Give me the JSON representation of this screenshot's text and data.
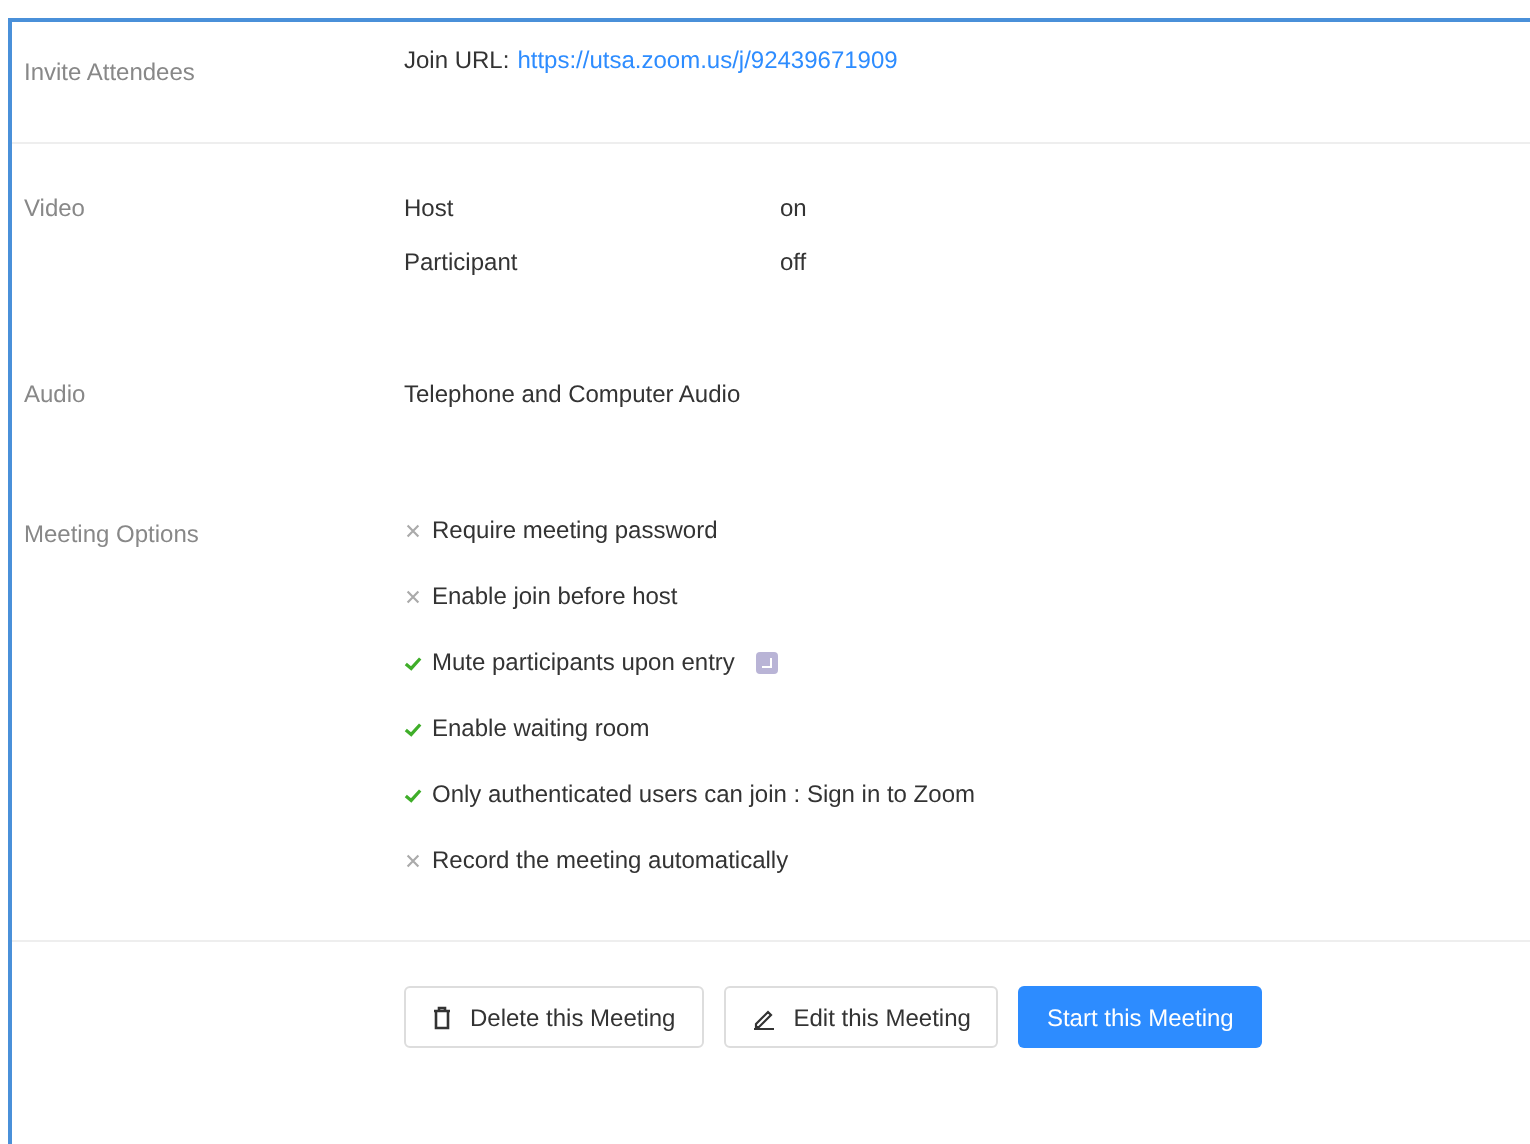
{
  "invite": {
    "label": "Invite Attendees",
    "url_label": "Join URL:",
    "url": "https://utsa.zoom.us/j/92439671909"
  },
  "video": {
    "label": "Video",
    "settings": [
      {
        "name": "Host",
        "value": "on"
      },
      {
        "name": "Participant",
        "value": "off"
      }
    ]
  },
  "audio": {
    "label": "Audio",
    "value": "Telephone and Computer Audio"
  },
  "meeting_options": {
    "label": "Meeting Options",
    "options": [
      {
        "text": "Require meeting password",
        "enabled": false,
        "badge": false
      },
      {
        "text": "Enable join before host",
        "enabled": false,
        "badge": false
      },
      {
        "text": "Mute participants upon entry",
        "enabled": true,
        "badge": true
      },
      {
        "text": "Enable waiting room",
        "enabled": true,
        "badge": false
      },
      {
        "text": "Only authenticated users can join : Sign in to Zoom",
        "enabled": true,
        "badge": false
      },
      {
        "text": "Record the meeting automatically",
        "enabled": false,
        "badge": false
      }
    ]
  },
  "buttons": [
    {
      "kind": "delete",
      "label": "Delete this Meeting"
    },
    {
      "kind": "edit",
      "label": "Edit this Meeting"
    },
    {
      "kind": "start",
      "label": "Start this Meeting"
    }
  ]
}
